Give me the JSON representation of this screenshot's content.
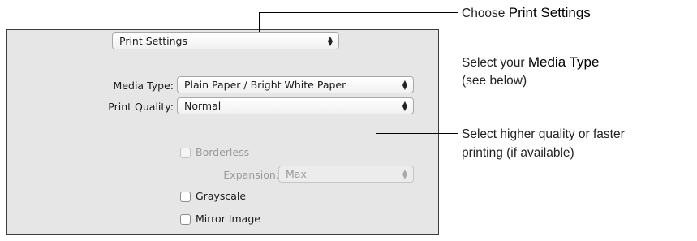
{
  "dialog": {
    "section_popup": {
      "value": "Print Settings"
    },
    "media_type": {
      "label": "Media Type:",
      "value": "Plain Paper / Bright White Paper"
    },
    "print_quality": {
      "label": "Print Quality:",
      "value": "Normal"
    },
    "borderless": {
      "label": "Borderless",
      "checked": false,
      "enabled": false
    },
    "expansion": {
      "label": "Expansion:",
      "value": "Max",
      "enabled": false
    },
    "grayscale": {
      "label": "Grayscale",
      "checked": false
    },
    "mirror_image": {
      "label": "Mirror Image",
      "checked": false
    }
  },
  "annotations": {
    "choose": {
      "pre": "Choose ",
      "strong": "Print Settings"
    },
    "media": {
      "pre": "Select your ",
      "strong": "Media Type",
      "line2": "(see below)"
    },
    "quality": {
      "line1": "Select higher quality or faster",
      "line2": "printing (if available)"
    }
  }
}
